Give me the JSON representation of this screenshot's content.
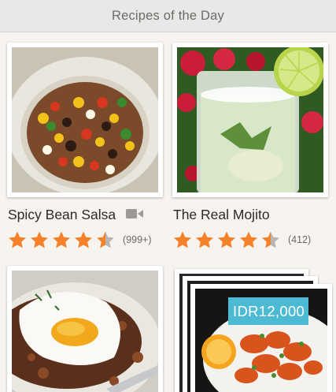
{
  "header": {
    "title": "Recipes of the Day"
  },
  "recipes": [
    {
      "title": "Spicy Bean Salsa",
      "has_video": true,
      "rating": 4.5,
      "rating_count": "(999+)",
      "video_icon": "video-camera-icon"
    },
    {
      "title": "The Real Mojito",
      "has_video": false,
      "rating": 4.5,
      "rating_count": "(412)"
    },
    {
      "title": "",
      "rating": null
    },
    {
      "title": "",
      "price": "IDR12,000"
    }
  ],
  "colors": {
    "star": "#f5822a",
    "star_empty": "#b8b6b3",
    "badge": "#4cbad3",
    "header_bg": "#e9e8e6"
  }
}
